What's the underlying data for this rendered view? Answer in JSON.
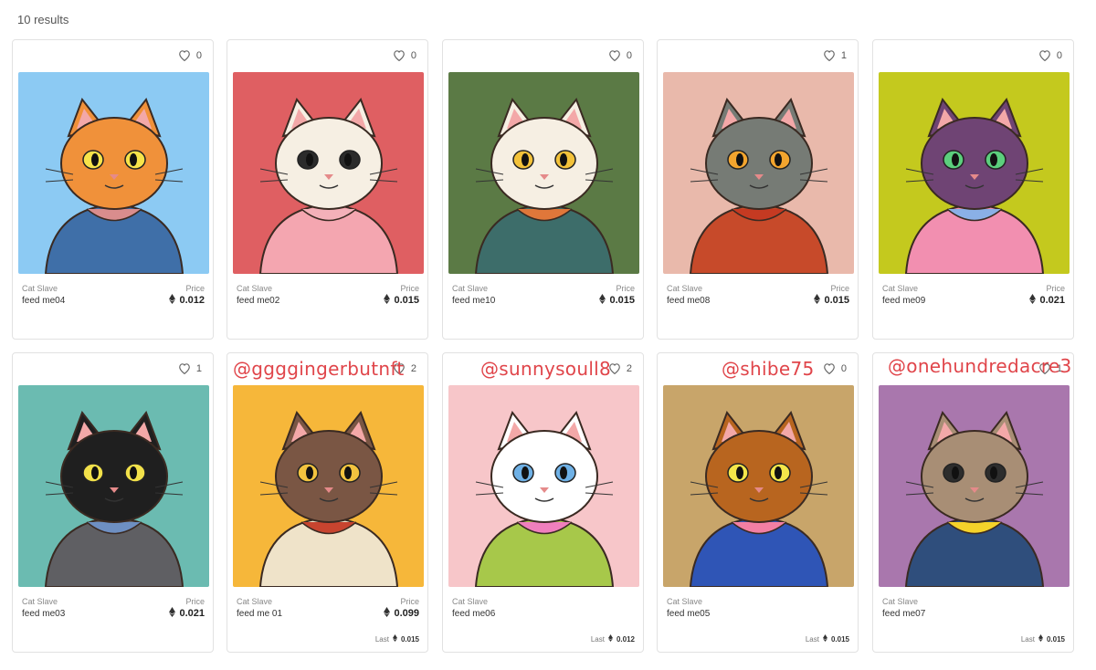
{
  "results_text": "10 results",
  "price_label": "Price",
  "last_label": "Last",
  "cards": [
    {
      "likes": "0",
      "collection": "Cat Slave",
      "name": "feed me04",
      "price": "0.012",
      "last": "",
      "bg": "#8ccaf3",
      "cat": "#f0913a",
      "eye": "#f7e34a",
      "accent": "#d98d8d",
      "outfit": "#3f6fa8"
    },
    {
      "likes": "0",
      "collection": "Cat Slave",
      "name": "feed me02",
      "price": "0.015",
      "last": "",
      "bg": "#df5f62",
      "cat": "#f6efe3",
      "eye": "#2b2b2b",
      "accent": "#f4b1b9",
      "outfit": "#f4a6b0"
    },
    {
      "likes": "0",
      "collection": "Cat Slave",
      "name": "feed me10",
      "price": "0.015",
      "last": "",
      "bg": "#5b7a45",
      "cat": "#f6efe3",
      "eye": "#f3c23a",
      "accent": "#e0773a",
      "outfit": "#3d6d6a"
    },
    {
      "likes": "1",
      "collection": "Cat Slave",
      "name": "feed me08",
      "price": "0.015",
      "last": "",
      "bg": "#e9b9ab",
      "cat": "#767b75",
      "eye": "#f3a52e",
      "accent": "#c53a22",
      "outfit": "#c74a2a"
    },
    {
      "likes": "0",
      "collection": "Cat Slave",
      "name": "feed me09",
      "price": "0.021",
      "last": "",
      "bg": "#c4c91e",
      "cat": "#6f4474",
      "eye": "#5ccf7d",
      "accent": "#8ab0e6",
      "outfit": "#f28fb0"
    },
    {
      "likes": "1",
      "collection": "Cat Slave",
      "name": "feed me03",
      "price": "0.021",
      "last": "",
      "bg": "#6bbbb1",
      "cat": "#1f1f1f",
      "eye": "#f2e14a",
      "accent": "#6e8fc2",
      "outfit": "#5f5f63"
    },
    {
      "likes": "2",
      "collection": "Cat Slave",
      "name": "feed me 01",
      "price": "0.099",
      "last": "0.015",
      "bg": "#f6b73a",
      "cat": "#7a5644",
      "eye": "#f2c33f",
      "accent": "#c7442f",
      "outfit": "#efe3c9"
    },
    {
      "likes": "2",
      "collection": "Cat Slave",
      "name": "feed me06",
      "price": "",
      "last": "0.012",
      "bg": "#f7c6c9",
      "cat": "#ffffff",
      "eye": "#6fb1e6",
      "accent": "#f07fbd",
      "outfit": "#a7c84a"
    },
    {
      "likes": "0",
      "collection": "Cat Slave",
      "name": "feed me05",
      "price": "",
      "last": "0.015",
      "bg": "#c8a56a",
      "cat": "#b8651f",
      "eye": "#f4e64a",
      "accent": "#f27fa3",
      "outfit": "#2f55b6"
    },
    {
      "likes": "1",
      "collection": "Cat Slave",
      "name": "feed me07",
      "price": "",
      "last": "0.015",
      "bg": "#a977ad",
      "cat": "#a88e75",
      "eye": "#2d2d2d",
      "accent": "#f5d22a",
      "outfit": "#2f4e7c"
    }
  ],
  "handles": [
    {
      "text": "@ggggingerbutnft"
    },
    {
      "text": "@sunnysoull8"
    },
    {
      "text": "@shibe75"
    },
    {
      "text": "@onehundredacre3"
    }
  ]
}
